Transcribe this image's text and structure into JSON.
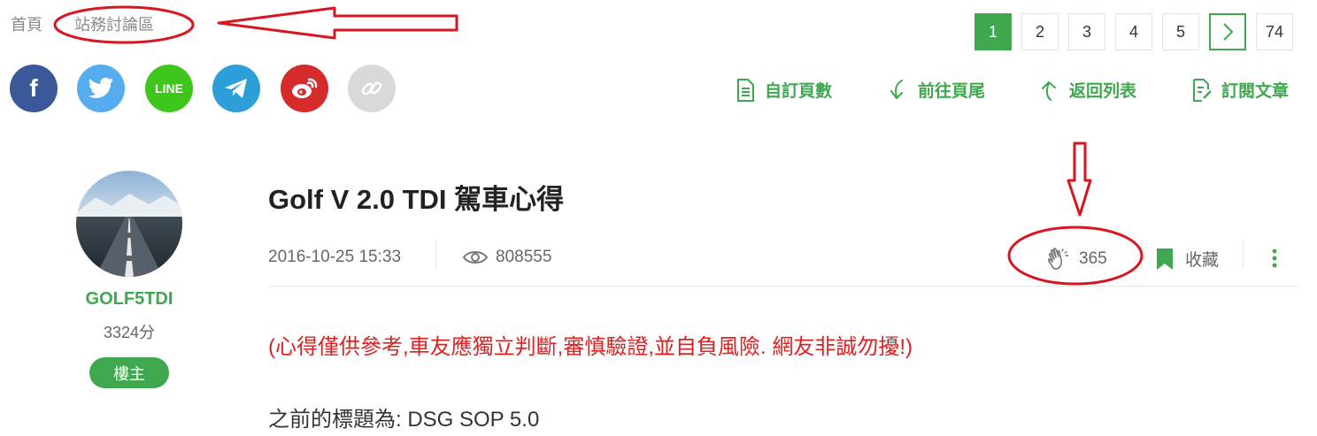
{
  "breadcrumb": {
    "home": "首頁",
    "forum": "站務討論區"
  },
  "pagination": {
    "pages": [
      "1",
      "2",
      "3",
      "4",
      "5"
    ],
    "current": "1",
    "last": "74"
  },
  "share": {
    "items": [
      {
        "name": "facebook",
        "label": "f",
        "color": "#3b5998"
      },
      {
        "name": "twitter",
        "label": "",
        "color": "#55acee"
      },
      {
        "name": "line",
        "label": "LINE",
        "color": "#3fc61c"
      },
      {
        "name": "telegram",
        "label": "",
        "color": "#2c9fd8"
      },
      {
        "name": "weibo",
        "label": "",
        "color": "#d52b2b"
      },
      {
        "name": "copy-link",
        "label": "",
        "color": "#d9d9d9"
      }
    ]
  },
  "toolbar": {
    "custom_pages": "自訂頁數",
    "go_bottom": "前往頁尾",
    "back_to_list": "返回列表",
    "subscribe": "訂閱文章"
  },
  "author": {
    "name": "GOLF5TDI",
    "score": "3324分",
    "badge": "樓主"
  },
  "post": {
    "title": "Golf V 2.0 TDI 駕車心得",
    "date": "2016-10-25 15:33",
    "views": "808555",
    "claps": "365",
    "bookmark_label": "收藏",
    "disclaimer": "(心得僅供參考,車友應獨立判斷,審慎驗證,並自負風險. 網友非誠勿擾!)",
    "previous_title": "之前的標題為: DSG SOP 5.0"
  },
  "colors": {
    "accent": "#3fa84e",
    "annotation": "#d9161f",
    "disclaimer": "#e02020"
  }
}
